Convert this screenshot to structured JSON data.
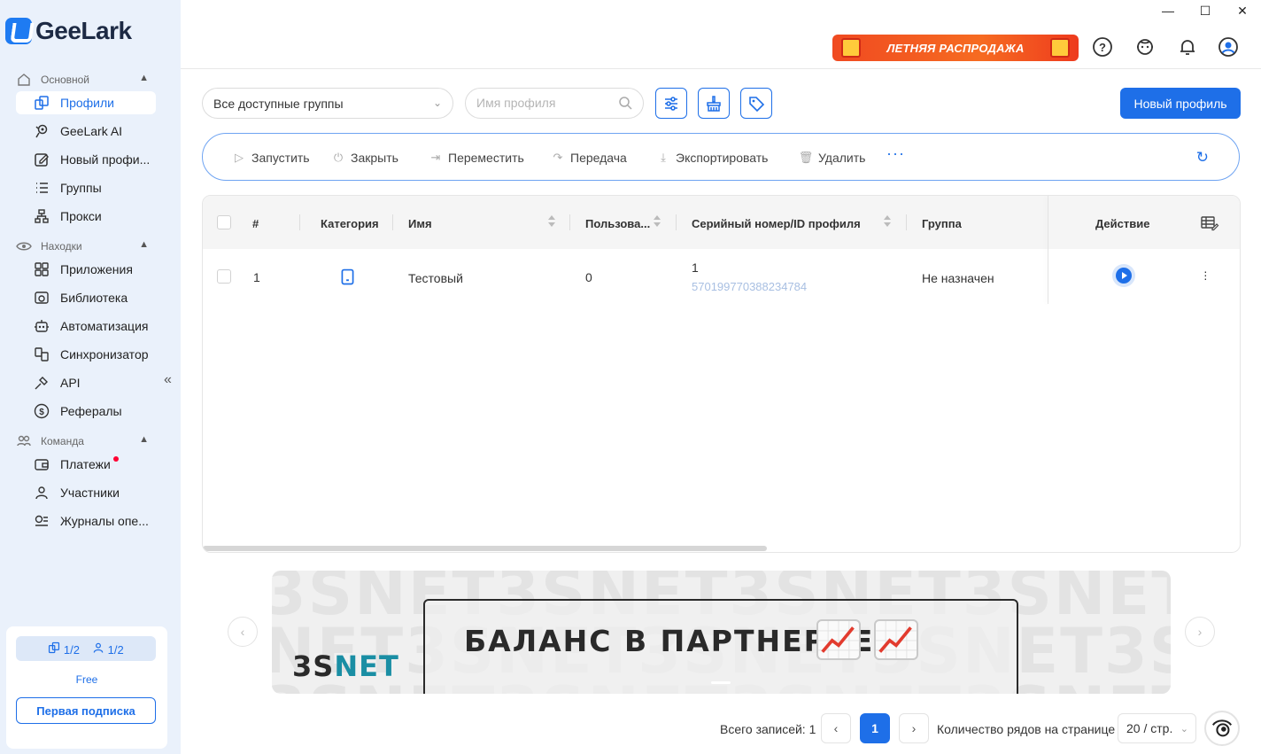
{
  "app": {
    "brand": "GeeLark"
  },
  "window": {
    "minimize": "—",
    "maximize": "☐",
    "close": "✕"
  },
  "sidebar": {
    "sections": [
      {
        "label": "Основной"
      },
      {
        "label": "Находки"
      },
      {
        "label": "Команда"
      }
    ],
    "items": [
      {
        "label": "Профили",
        "icon": "profiles-icon",
        "active": true
      },
      {
        "label": "GeeLark AI",
        "icon": "ai-icon"
      },
      {
        "label": "Новый профи...",
        "icon": "edit-icon"
      },
      {
        "label": "Группы",
        "icon": "list-icon"
      },
      {
        "label": "Прокси",
        "icon": "proxy-icon"
      },
      {
        "label": "Приложения",
        "icon": "apps-icon"
      },
      {
        "label": "Библиотека",
        "icon": "library-icon"
      },
      {
        "label": "Автоматизация",
        "icon": "robot-icon"
      },
      {
        "label": "Синхронизатор",
        "icon": "sync-icon"
      },
      {
        "label": "API",
        "icon": "api-icon"
      },
      {
        "label": "Рефералы",
        "icon": "dollar-icon"
      },
      {
        "label": "Платежи",
        "icon": "wallet-icon",
        "notification": true
      },
      {
        "label": "Участники",
        "icon": "user-icon"
      },
      {
        "label": "Журналы опе...",
        "icon": "logs-icon"
      }
    ],
    "plan": {
      "profiles_count": "1/2",
      "members_count": "1/2",
      "name": "Free",
      "subscribe_label": "Первая подписка"
    }
  },
  "header": {
    "promo_label": "ЛЕТНЯЯ РАСПРОДАЖА",
    "icons": [
      "help-icon",
      "support-icon",
      "bell-icon",
      "account-icon"
    ]
  },
  "toolbar": {
    "group_select": "Все доступные группы",
    "search_placeholder": "Имя профиля",
    "new_profile_label": "Новый профиль"
  },
  "actions": {
    "start": "Запустить",
    "close": "Закрыть",
    "move": "Переместить",
    "transfer": "Передача",
    "export": "Экспортировать",
    "delete": "Удалить",
    "more": "···"
  },
  "table": {
    "columns": {
      "num": "#",
      "category": "Категория",
      "name": "Имя",
      "user": "Пользова...",
      "serial": "Серийный номер/ID профиля",
      "group": "Группа",
      "action": "Действие"
    },
    "rows": [
      {
        "num": "1",
        "category": "phone-icon",
        "name": "Тестовый",
        "user": "0",
        "serial": "1",
        "profile_id": "570199770388234784",
        "group": "Не назначен"
      }
    ]
  },
  "banner": {
    "logo_part1": "3S",
    "logo_part2": "NET",
    "headline": "БАЛАНС В ПАРТНЕРКЕ:",
    "background_text": "3SNET3SNET3SNET3SNET3SNE",
    "background_text2": "NET3SNET3SNET3SNET3SNET",
    "background_text3": "3SNET3SNET3SNET3SNET3SNE"
  },
  "pagination": {
    "total_label": "Всего записей: 1",
    "current_page": "1",
    "rows_label": "Количество рядов на странице",
    "page_size": "20 / стр."
  },
  "colors": {
    "accent": "#1e6fe8",
    "sidebar_bg": "#eaf1fb",
    "promo": "#f04a21"
  }
}
